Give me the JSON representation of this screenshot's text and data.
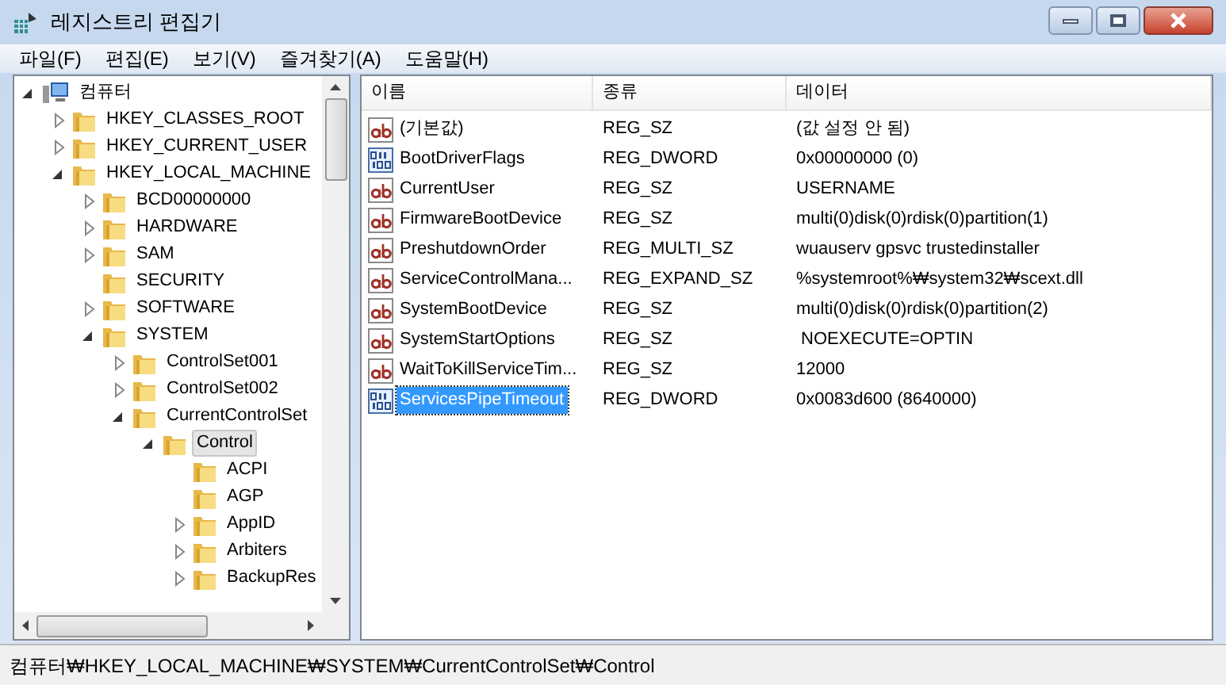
{
  "window": {
    "title": "레지스트리 편집기"
  },
  "menu": [
    "파일(F)",
    "편집(E)",
    "보기(V)",
    "즐겨찾기(A)",
    "도움말(H)"
  ],
  "tree": [
    {
      "name": "컴퓨터",
      "kind": "computer",
      "expanded": true,
      "selected": false,
      "children": [
        {
          "name": "HKEY_CLASSES_ROOT",
          "kind": "folder",
          "expanded": false,
          "selected": false
        },
        {
          "name": "HKEY_CURRENT_USER",
          "kind": "folder",
          "expanded": false,
          "selected": false
        },
        {
          "name": "HKEY_LOCAL_MACHINE",
          "kind": "folder",
          "expanded": true,
          "selected": false,
          "children": [
            {
              "name": "BCD00000000",
              "kind": "folder",
              "expanded": false,
              "selected": false
            },
            {
              "name": "HARDWARE",
              "kind": "folder",
              "expanded": false,
              "selected": false
            },
            {
              "name": "SAM",
              "kind": "folder",
              "expanded": false,
              "selected": false
            },
            {
              "name": "SECURITY",
              "kind": "folder",
              "selected": false
            },
            {
              "name": "SOFTWARE",
              "kind": "folder",
              "expanded": false,
              "selected": false
            },
            {
              "name": "SYSTEM",
              "kind": "folder",
              "expanded": true,
              "selected": false,
              "children": [
                {
                  "name": "ControlSet001",
                  "kind": "folder",
                  "expanded": false,
                  "selected": false
                },
                {
                  "name": "ControlSet002",
                  "kind": "folder",
                  "expanded": false,
                  "selected": false
                },
                {
                  "name": "CurrentControlSet",
                  "kind": "folder",
                  "expanded": true,
                  "selected": false,
                  "children": [
                    {
                      "name": "Control",
                      "kind": "folder",
                      "expanded": true,
                      "selected": true,
                      "children": [
                        {
                          "name": "ACPI",
                          "kind": "folder",
                          "selected": false
                        },
                        {
                          "name": "AGP",
                          "kind": "folder",
                          "selected": false
                        },
                        {
                          "name": "AppID",
                          "kind": "folder",
                          "expanded": false,
                          "selected": false
                        },
                        {
                          "name": "Arbiters",
                          "kind": "folder",
                          "expanded": false,
                          "selected": false
                        },
                        {
                          "name": "BackupRes",
                          "kind": "folder",
                          "expanded": false,
                          "selected": false
                        }
                      ]
                    }
                  ]
                }
              ]
            }
          ]
        }
      ]
    }
  ],
  "table": {
    "columns": [
      "이름",
      "종류",
      "데이터"
    ],
    "rows": [
      {
        "kind": "string",
        "name": "(기본값)",
        "type": "REG_SZ",
        "data": "(값 설정 안 됨)",
        "selected": false
      },
      {
        "kind": "binary",
        "name": "BootDriverFlags",
        "type": "REG_DWORD",
        "data": "0x00000000 (0)",
        "selected": false
      },
      {
        "kind": "string",
        "name": "CurrentUser",
        "type": "REG_SZ",
        "data": "USERNAME",
        "selected": false
      },
      {
        "kind": "string",
        "name": "FirmwareBootDevice",
        "type": "REG_SZ",
        "data": "multi(0)disk(0)rdisk(0)partition(1)",
        "selected": false
      },
      {
        "kind": "string",
        "name": "PreshutdownOrder",
        "type": "REG_MULTI_SZ",
        "data": "wuauserv gpsvc trustedinstaller",
        "selected": false
      },
      {
        "kind": "string",
        "name": "ServiceControlMana...",
        "type": "REG_EXPAND_SZ",
        "data": "%systemroot%₩system32₩scext.dll",
        "selected": false
      },
      {
        "kind": "string",
        "name": "SystemBootDevice",
        "type": "REG_SZ",
        "data": "multi(0)disk(0)rdisk(0)partition(2)",
        "selected": false
      },
      {
        "kind": "string",
        "name": "SystemStartOptions",
        "type": "REG_SZ",
        "data": " NOEXECUTE=OPTIN",
        "selected": false
      },
      {
        "kind": "string",
        "name": "WaitToKillServiceTim...",
        "type": "REG_SZ",
        "data": "12000",
        "selected": false
      },
      {
        "kind": "binary",
        "name": "ServicesPipeTimeout",
        "type": "REG_DWORD",
        "data": "0x0083d600 (8640000)",
        "selected": true
      }
    ]
  },
  "status_bar": "컴퓨터₩HKEY_LOCAL_MACHINE₩SYSTEM₩CurrentControlSet₩Control"
}
